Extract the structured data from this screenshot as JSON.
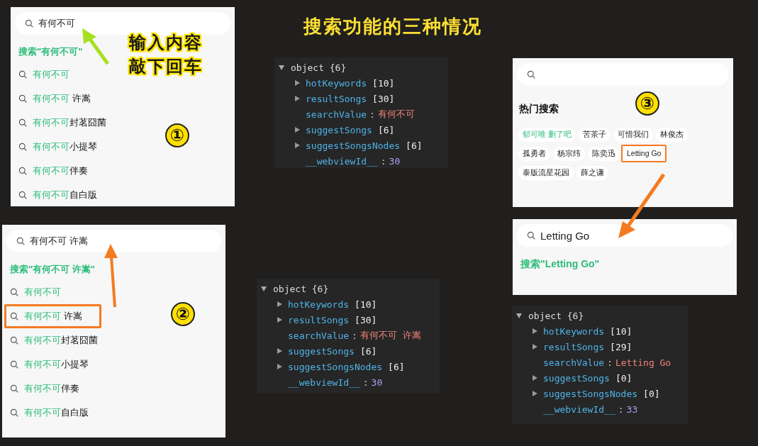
{
  "title": "搜索功能的三种情况",
  "screens": [
    {
      "kind": "suggest",
      "marker": "①",
      "query": "有何不可",
      "notes": [
        "输入内容",
        "敲下回车"
      ],
      "search_all": "搜索\"有何不可\"",
      "suggestions": [
        {
          "match": "有何不可",
          "highlighted": false
        },
        {
          "match": "有何不可",
          "rest": " 许嵩",
          "highlighted": false
        },
        {
          "match": "有何不可",
          "rest": "封茗囧菌",
          "highlighted": false
        },
        {
          "match": "有何不可",
          "rest": "小提琴",
          "highlighted": false
        },
        {
          "match": "有何不可",
          "rest": "伴奏",
          "highlighted": false
        },
        {
          "match": "有何不可",
          "rest": "自白版",
          "highlighted": false
        }
      ]
    },
    {
      "kind": "suggest",
      "marker": "②",
      "query": "有何不可 许嵩",
      "search_all": "搜索\"有何不可 许嵩\"",
      "suggestions": [
        {
          "match": "有何不可",
          "highlighted": false
        },
        {
          "match": "有何不可",
          "rest": " 许嵩",
          "highlighted": true
        },
        {
          "match": "有何不可",
          "rest": "封茗囧菌",
          "highlighted": false
        },
        {
          "match": "有何不可",
          "rest": "小提琴",
          "highlighted": false
        },
        {
          "match": "有何不可",
          "rest": "伴奏",
          "highlighted": false
        },
        {
          "match": "有何不可",
          "rest": "自白版",
          "highlighted": false
        }
      ]
    },
    {
      "kind": "hot",
      "marker": "③",
      "heading": "热门搜索",
      "tags": [
        {
          "label": "郁可唯 删了吧",
          "accent": true,
          "highlighted": false
        },
        {
          "label": "苦茶子",
          "accent": false,
          "highlighted": false
        },
        {
          "label": "可惜我们",
          "accent": false,
          "highlighted": false
        },
        {
          "label": "林俊杰",
          "accent": false,
          "highlighted": false
        },
        {
          "label": "孤勇者",
          "accent": false,
          "highlighted": false
        },
        {
          "label": "杨宗纬",
          "accent": false,
          "highlighted": false
        },
        {
          "label": "陈奕迅",
          "accent": false,
          "highlighted": false
        },
        {
          "label": "Letting Go",
          "accent": false,
          "highlighted": true
        },
        {
          "label": "泰版流星花园",
          "accent": false,
          "highlighted": false
        },
        {
          "label": "薛之谦",
          "accent": false,
          "highlighted": false
        }
      ]
    },
    {
      "kind": "suggest",
      "query": "Letting Go",
      "search_all": "搜索\"Letting Go\""
    }
  ],
  "inspectors": [
    {
      "header": "object {6}",
      "expanded": true,
      "fields": [
        {
          "key": "hotKeywords",
          "kind": "array",
          "value": "[10]",
          "expanded": false
        },
        {
          "key": "resultSongs",
          "kind": "array",
          "value": "[30]",
          "expanded": false
        },
        {
          "key": "searchValue",
          "kind": "string",
          "separator": ":",
          "value": "有何不可"
        },
        {
          "key": "suggestSongs",
          "kind": "array",
          "value": "[6]",
          "expanded": false
        },
        {
          "key": "suggestSongsNodes",
          "kind": "array",
          "value": "[6]",
          "expanded": false
        },
        {
          "key": "__webviewId__",
          "kind": "number",
          "separator": ":",
          "value": "30"
        }
      ]
    },
    {
      "header": "object {6}",
      "expanded": true,
      "fields": [
        {
          "key": "hotKeywords",
          "kind": "array",
          "value": "[10]",
          "expanded": false
        },
        {
          "key": "resultSongs",
          "kind": "array",
          "value": "[30]",
          "expanded": false
        },
        {
          "key": "searchValue",
          "kind": "string",
          "separator": ":",
          "value": "有何不可 许嵩"
        },
        {
          "key": "suggestSongs",
          "kind": "array",
          "value": "[6]",
          "expanded": false
        },
        {
          "key": "suggestSongsNodes",
          "kind": "array",
          "value": "[6]",
          "expanded": false
        },
        {
          "key": "__webviewId__",
          "kind": "number",
          "separator": ":",
          "value": "30"
        }
      ]
    },
    {
      "header": "object {6}",
      "expanded": true,
      "fields": [
        {
          "key": "hotKeywords",
          "kind": "array",
          "value": "[10]",
          "expanded": false
        },
        {
          "key": "resultSongs",
          "kind": "array",
          "value": "[29]",
          "expanded": false
        },
        {
          "key": "searchValue",
          "kind": "string",
          "separator": ":",
          "value": "Letting Go"
        },
        {
          "key": "suggestSongs",
          "kind": "array",
          "value": "[0]",
          "expanded": false
        },
        {
          "key": "suggestSongsNodes",
          "kind": "array",
          "value": "[0]",
          "expanded": false
        },
        {
          "key": "__webviewId__",
          "kind": "number",
          "separator": ":",
          "value": "33"
        }
      ]
    }
  ]
}
